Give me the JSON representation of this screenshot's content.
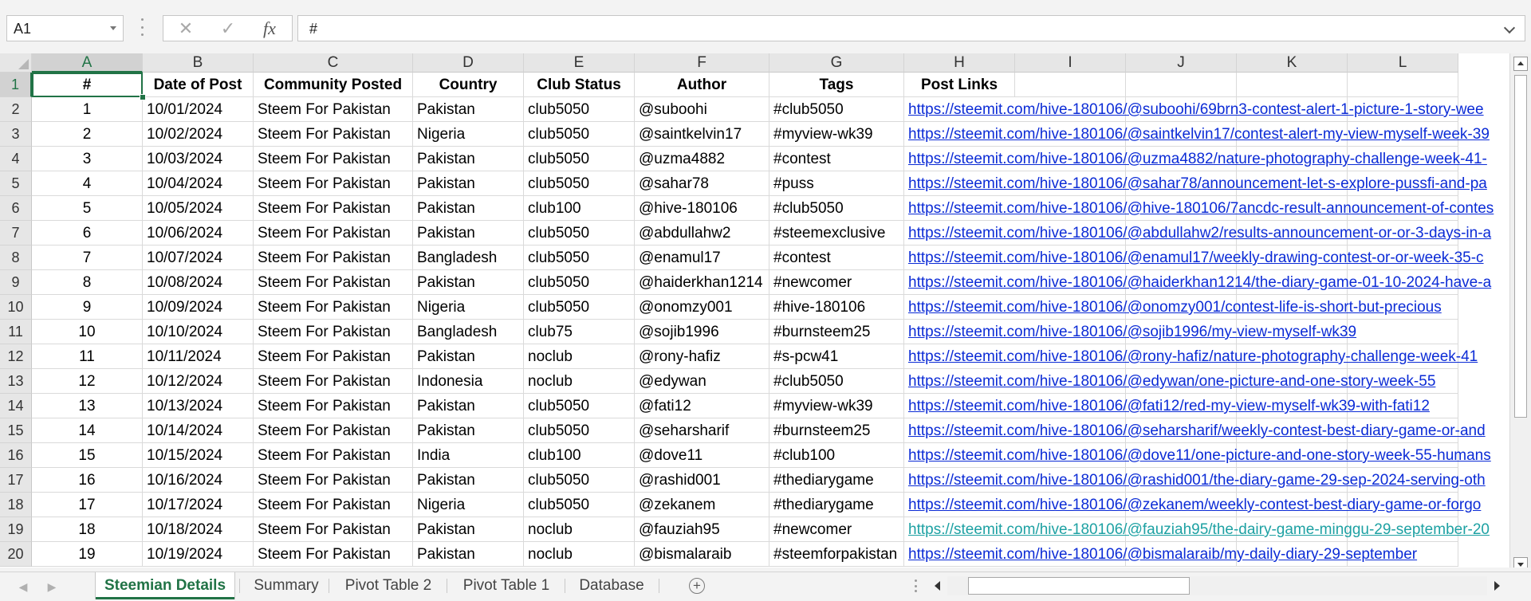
{
  "formula_bar": {
    "name_box": "A1",
    "cancel_glyph": "✕",
    "enter_glyph": "✓",
    "fx_label": "fx",
    "formula": "#"
  },
  "columns": [
    "A",
    "B",
    "C",
    "D",
    "E",
    "F",
    "G",
    "H",
    "I",
    "J",
    "K",
    "L"
  ],
  "header_row": [
    "#",
    "Date of Post",
    "Community Posted",
    "Country",
    "Club Status",
    "Author",
    "Tags",
    "Post Links"
  ],
  "rows": [
    [
      "1",
      "10/01/2024",
      "Steem For Pakistan",
      "Pakistan",
      "club5050",
      "@suboohi",
      "#club5050",
      "https://steemit.com/hive-180106/@suboohi/69brn3-contest-alert-1-picture-1-story-wee"
    ],
    [
      "2",
      "10/02/2024",
      "Steem For Pakistan",
      "Nigeria",
      "club5050",
      "@saintkelvin17",
      "#myview-wk39",
      "https://steemit.com/hive-180106/@saintkelvin17/contest-alert-my-view-myself-week-39"
    ],
    [
      "3",
      "10/03/2024",
      "Steem For Pakistan",
      "Pakistan",
      "club5050",
      "@uzma4882",
      "#contest",
      "https://steemit.com/hive-180106/@uzma4882/nature-photography-challenge-week-41-"
    ],
    [
      "4",
      "10/04/2024",
      "Steem For Pakistan",
      "Pakistan",
      "club5050",
      "@sahar78",
      "#puss",
      "https://steemit.com/hive-180106/@sahar78/announcement-let-s-explore-pussfi-and-pa"
    ],
    [
      "5",
      "10/05/2024",
      "Steem For Pakistan",
      "Pakistan",
      "club100",
      "@hive-180106",
      "#club5050",
      "https://steemit.com/hive-180106/@hive-180106/7ancdc-result-announcement-of-contes"
    ],
    [
      "6",
      "10/06/2024",
      "Steem For Pakistan",
      "Pakistan",
      "club5050",
      "@abdullahw2",
      "#steemexclusive",
      "https://steemit.com/hive-180106/@abdullahw2/results-announcement-or-or-3-days-in-a"
    ],
    [
      "7",
      "10/07/2024",
      "Steem For Pakistan",
      "Bangladesh",
      "club5050",
      "@enamul17",
      "#contest",
      "https://steemit.com/hive-180106/@enamul17/weekly-drawing-contest-or-or-week-35-c"
    ],
    [
      "8",
      "10/08/2024",
      "Steem For Pakistan",
      "Pakistan",
      "club5050",
      "@haiderkhan1214",
      "#newcomer",
      "https://steemit.com/hive-180106/@haiderkhan1214/the-diary-game-01-10-2024-have-a"
    ],
    [
      "9",
      "10/09/2024",
      "Steem For Pakistan",
      "Nigeria",
      "club5050",
      "@onomzy001",
      "#hive-180106",
      "https://steemit.com/hive-180106/@onomzy001/contest-life-is-short-but-precious"
    ],
    [
      "10",
      "10/10/2024",
      "Steem For Pakistan",
      "Bangladesh",
      "club75",
      "@sojib1996",
      "#burnsteem25",
      "https://steemit.com/hive-180106/@sojib1996/my-view-myself-wk39"
    ],
    [
      "11",
      "10/11/2024",
      "Steem For Pakistan",
      "Pakistan",
      "noclub",
      "@rony-hafiz",
      "#s-pcw41",
      "https://steemit.com/hive-180106/@rony-hafiz/nature-photography-challenge-week-41"
    ],
    [
      "12",
      "10/12/2024",
      "Steem For Pakistan",
      "Indonesia",
      "noclub",
      "@edywan",
      "#club5050",
      "https://steemit.com/hive-180106/@edywan/one-picture-and-one-story-week-55"
    ],
    [
      "13",
      "10/13/2024",
      "Steem For Pakistan",
      "Pakistan",
      "club5050",
      "@fati12",
      "#myview-wk39",
      "https://steemit.com/hive-180106/@fati12/red-my-view-myself-wk39-with-fati12"
    ],
    [
      "14",
      "10/14/2024",
      "Steem For Pakistan",
      "Pakistan",
      "club5050",
      "@seharsharif",
      "#burnsteem25",
      "https://steemit.com/hive-180106/@seharsharif/weekly-contest-best-diary-game-or-and"
    ],
    [
      "15",
      "10/15/2024",
      "Steem For Pakistan",
      "India",
      "club100",
      "@dove11",
      "#club100",
      "https://steemit.com/hive-180106/@dove11/one-picture-and-one-story-week-55-humans"
    ],
    [
      "16",
      "10/16/2024",
      "Steem For Pakistan",
      "Pakistan",
      "club5050",
      "@rashid001",
      "#thediarygame",
      "https://steemit.com/hive-180106/@rashid001/the-diary-game-29-sep-2024-serving-oth"
    ],
    [
      "17",
      "10/17/2024",
      "Steem For Pakistan",
      "Nigeria",
      "club5050",
      "@zekanem",
      "#thediarygame",
      "https://steemit.com/hive-180106/@zekanem/weekly-contest-best-diary-game-or-forgo"
    ],
    [
      "18",
      "10/18/2024",
      "Steem For Pakistan",
      "Pakistan",
      "noclub",
      "@fauziah95",
      "#newcomer",
      "https://steemit.com/hive-180106/@fauziah95/the-dairy-game-minggu-29-september-20"
    ],
    [
      "19",
      "10/19/2024",
      "Steem For Pakistan",
      "Pakistan",
      "noclub",
      "@bismalaraib",
      "#steemforpakistan",
      "https://steemit.com/hive-180106/@bismalaraib/my-daily-diary-29-september"
    ]
  ],
  "sheet_tabs": [
    "Steemian Details",
    "Summary",
    "Pivot Table 2",
    "Pivot Table 1",
    "Database"
  ],
  "active_tab": "Steemian Details",
  "add_sheet_glyph": "+",
  "colors": {
    "accent": "#217346",
    "link": "#0b2bd6",
    "visited_link": "#1da1a3"
  }
}
